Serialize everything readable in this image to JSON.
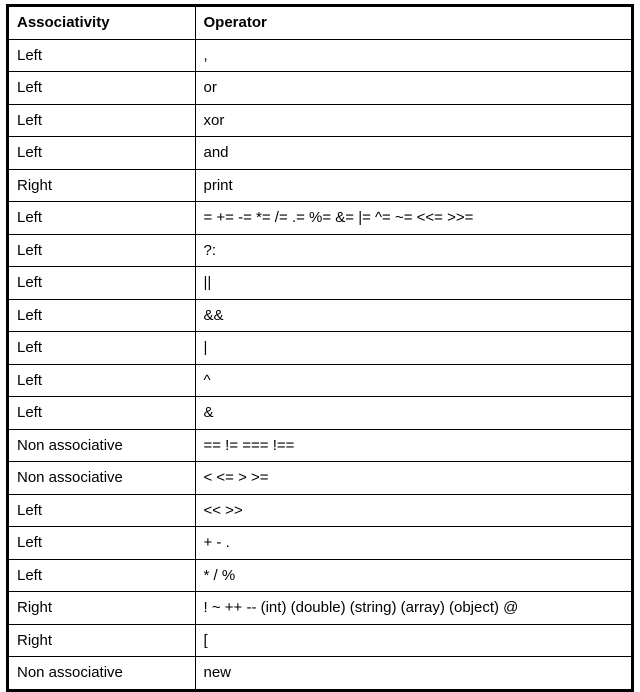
{
  "table": {
    "headers": {
      "assoc": "Associativity",
      "op": "Operator"
    },
    "rows": [
      {
        "assoc": "Left",
        "op": ","
      },
      {
        "assoc": "Left",
        "op": "or"
      },
      {
        "assoc": "Left",
        "op": "xor"
      },
      {
        "assoc": "Left",
        "op": "and"
      },
      {
        "assoc": "Right",
        "op": "print"
      },
      {
        "assoc": "Left",
        "op": "= += -= *= /= .= %= &= |= ^= ~= <<= >>="
      },
      {
        "assoc": "Left",
        "op": "?:"
      },
      {
        "assoc": "Left",
        "op": "||"
      },
      {
        "assoc": "Left",
        "op": "&&"
      },
      {
        "assoc": "Left",
        "op": "|"
      },
      {
        "assoc": "Left",
        "op": "^"
      },
      {
        "assoc": "Left",
        "op": "&"
      },
      {
        "assoc": "Non associative",
        "op": "== != === !=="
      },
      {
        "assoc": "Non associative",
        "op": "< <= > >="
      },
      {
        "assoc": "Left",
        "op": "<< >>"
      },
      {
        "assoc": "Left",
        "op": "+ - ."
      },
      {
        "assoc": "Left",
        "op": "* / %"
      },
      {
        "assoc": "Right",
        "op": "! ~ ++ -- (int) (double) (string) (array) (object) @"
      },
      {
        "assoc": "Right",
        "op": "["
      },
      {
        "assoc": "Non associative",
        "op": "new"
      }
    ]
  }
}
